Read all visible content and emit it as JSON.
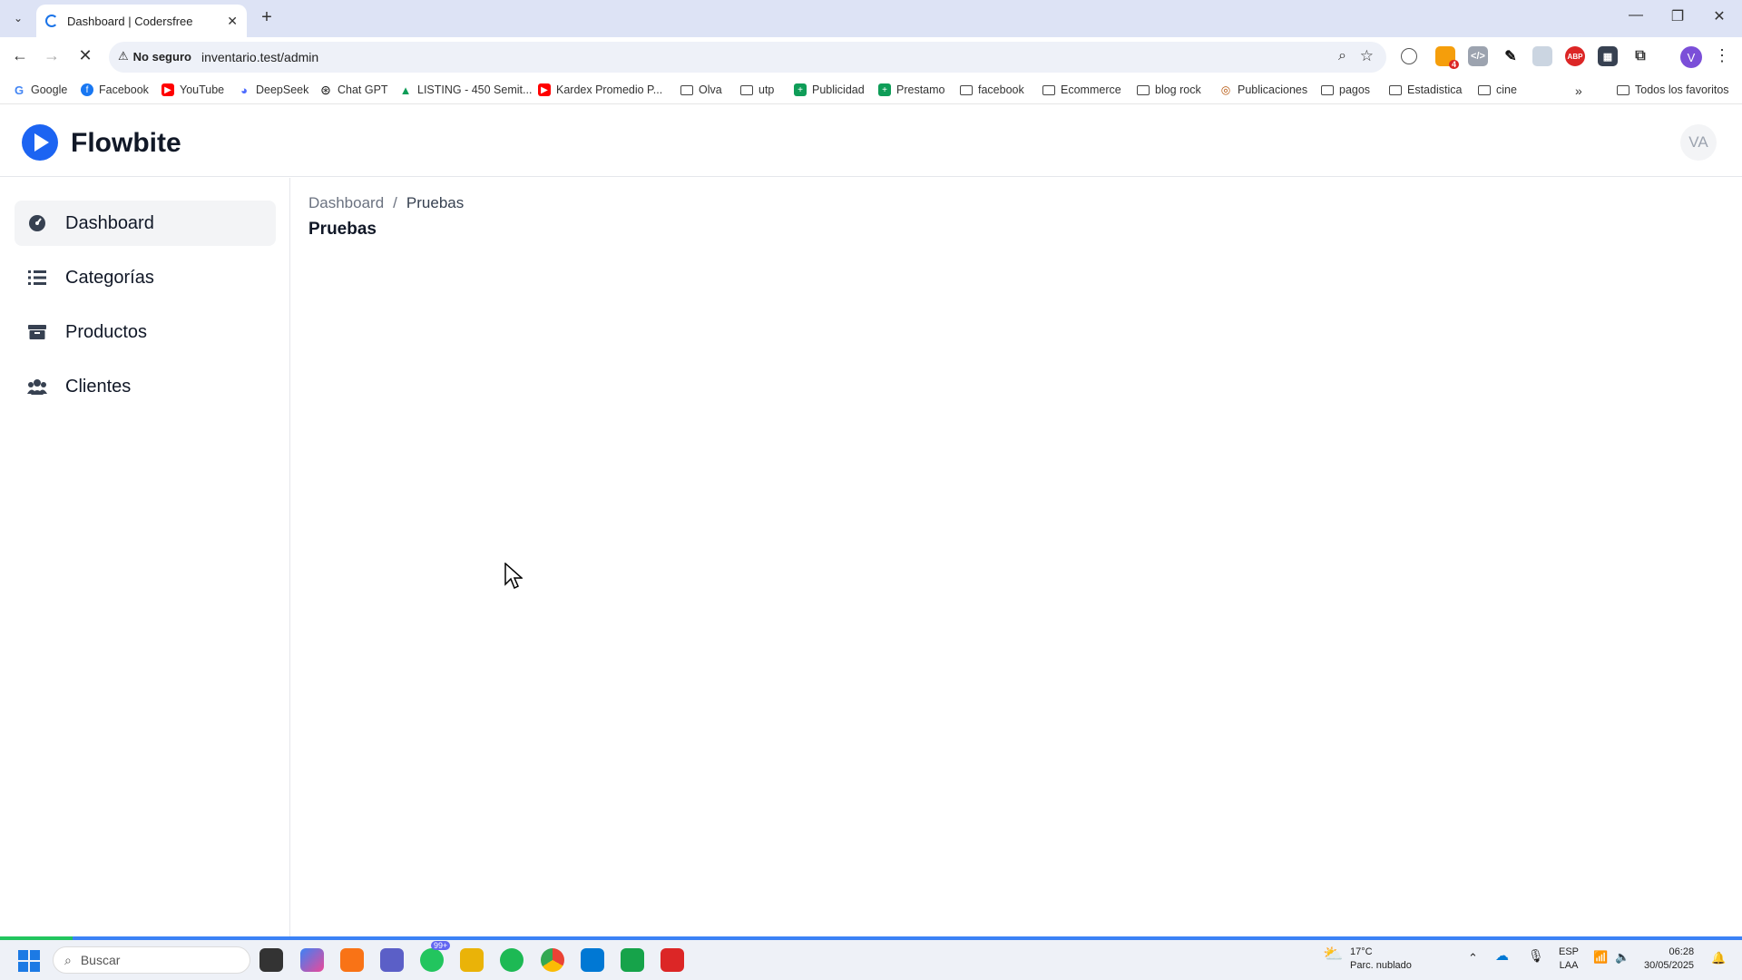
{
  "browser": {
    "tab_title": "Dashboard | Codersfree",
    "security_label": "No seguro",
    "url": "inventario.test/admin",
    "profile_initial": "V",
    "extension_badge": "4"
  },
  "bookmarks": [
    {
      "label": "Google",
      "icon": "google-icon"
    },
    {
      "label": "Facebook",
      "icon": "facebook-icon"
    },
    {
      "label": "YouTube",
      "icon": "youtube-icon"
    },
    {
      "label": "DeepSeek",
      "icon": "deepseek-icon"
    },
    {
      "label": "Chat GPT",
      "icon": "chatgpt-icon"
    },
    {
      "label": "LISTING - 450 Semit...",
      "icon": "drive-icon"
    },
    {
      "label": "Kardex Promedio P...",
      "icon": "youtube-icon"
    },
    {
      "label": "Olva",
      "icon": "folder-icon"
    },
    {
      "label": "utp",
      "icon": "folder-icon"
    },
    {
      "label": "Publicidad",
      "icon": "sheets-icon"
    },
    {
      "label": "Prestamo",
      "icon": "sheets-icon"
    },
    {
      "label": "facebook",
      "icon": "folder-icon"
    },
    {
      "label": "Ecommerce",
      "icon": "folder-icon"
    },
    {
      "label": "blog rock",
      "icon": "folder-icon"
    },
    {
      "label": "Publicaciones",
      "icon": "link-icon"
    },
    {
      "label": "pagos",
      "icon": "folder-icon"
    },
    {
      "label": "Estadistica",
      "icon": "folder-icon"
    },
    {
      "label": "cine",
      "icon": "folder-icon"
    }
  ],
  "all_bookmarks_label": "Todos los favoritos",
  "app": {
    "brand": "Flowbite",
    "user_initials": "VA"
  },
  "sidebar": {
    "items": [
      {
        "label": "Dashboard",
        "icon": "gauge-icon"
      },
      {
        "label": "Categorías",
        "icon": "list-icon"
      },
      {
        "label": "Productos",
        "icon": "box-icon"
      },
      {
        "label": "Clientes",
        "icon": "users-icon"
      }
    ]
  },
  "main": {
    "breadcrumb": [
      "Dashboard",
      "/",
      "Pruebas"
    ],
    "title": "Pruebas"
  },
  "taskbar": {
    "search_placeholder": "Buscar",
    "notification_badge": "99+",
    "weather_temp": "17°C",
    "weather_desc": "Parc. nublado",
    "lang_top": "ESP",
    "lang_bottom": "LAA",
    "time": "06:28",
    "date": "30/05/2025"
  },
  "colors": {
    "accent": "#1c64f2",
    "progress": "#3b82f6"
  }
}
